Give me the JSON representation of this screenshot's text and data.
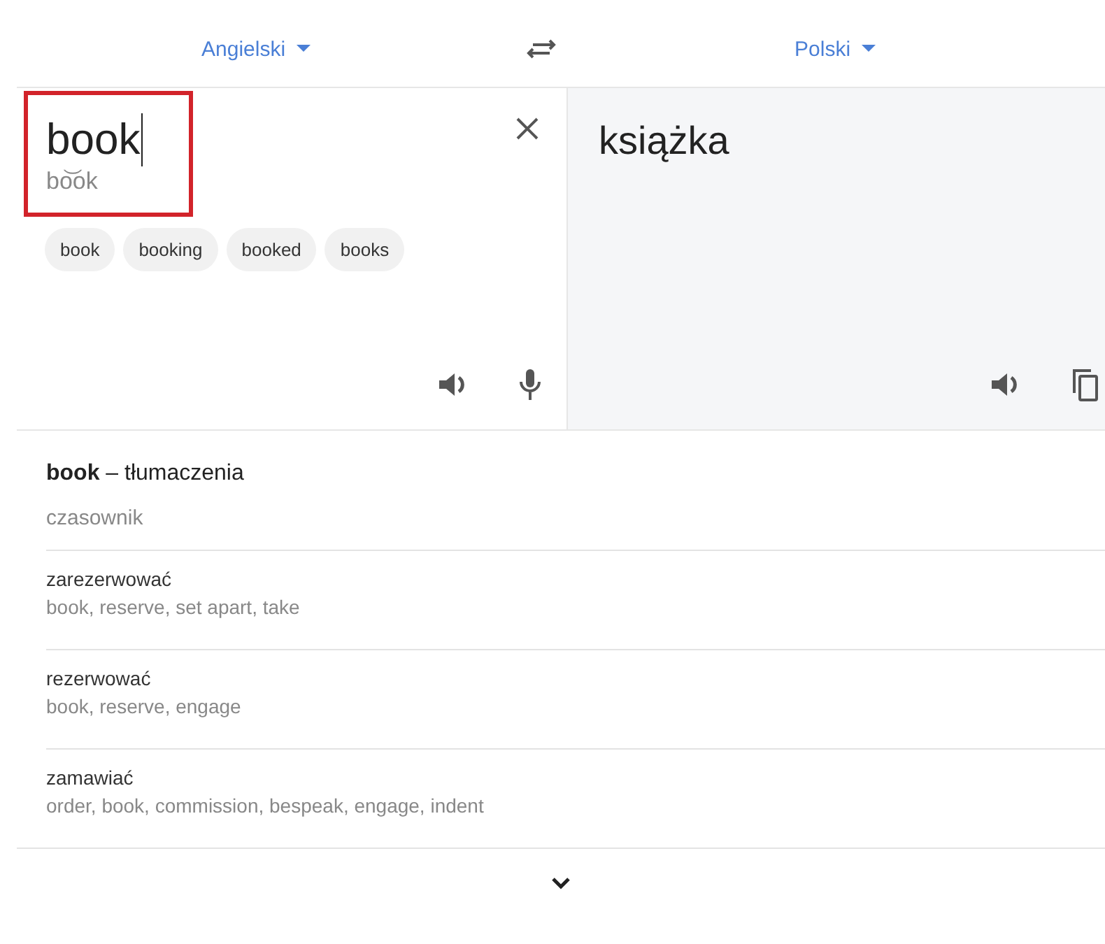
{
  "languages": {
    "source": "Angielski",
    "target": "Polski"
  },
  "input": {
    "value": "book",
    "transliteration": "bo͝ok",
    "highlighted": true
  },
  "suggestions": [
    "book",
    "booking",
    "booked",
    "books"
  ],
  "output": {
    "text": "książka"
  },
  "dictionary": {
    "heading": "**book** – tłumaczenia",
    "part_of_speech": "czasownik",
    "entries": [
      {
        "word": "zarezerwować",
        "synonyms": "book, reserve, set apart, take"
      },
      {
        "word": "rezerwować",
        "synonyms": "book, reserve, engage"
      },
      {
        "word": "zamawiać",
        "synonyms": "order, book, commission, bespeak, engage, indent"
      }
    ]
  }
}
